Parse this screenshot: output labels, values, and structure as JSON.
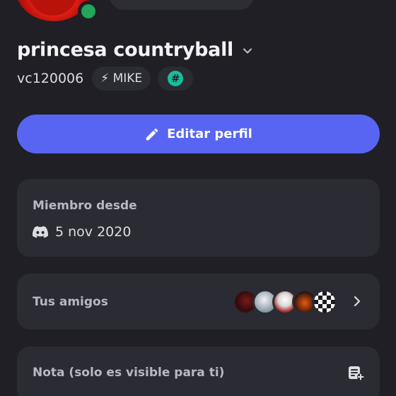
{
  "profile": {
    "display_name": "princesa countryball",
    "username": "vc120006",
    "badges": [
      {
        "icon": "lightning-icon",
        "label": "⚡ MIKE"
      },
      {
        "icon": "hashtag-icon",
        "label": "#"
      }
    ]
  },
  "actions": {
    "edit_profile_label": "Editar perfil"
  },
  "member_since": {
    "title": "Miembro desde",
    "date": "5 nov 2020"
  },
  "friends": {
    "label": "Tus amigos"
  },
  "note": {
    "label": "Nota (solo es visible para ti)"
  },
  "colors": {
    "background": "#1f1f25",
    "card": "#2a2b33",
    "accent": "#5865f2",
    "online": "#23a55a",
    "badge_green": "#1abc9c"
  }
}
